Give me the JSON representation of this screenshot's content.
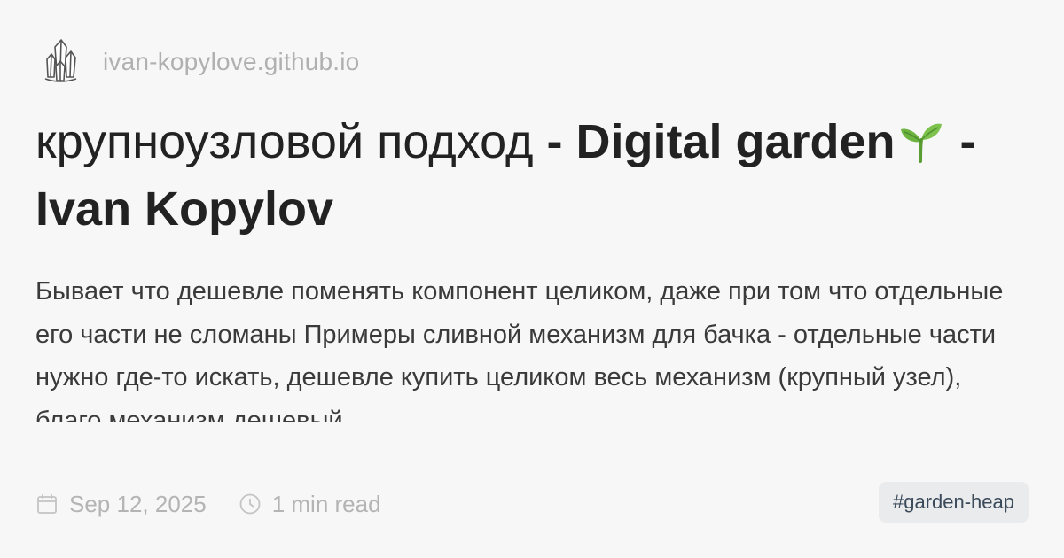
{
  "site": {
    "logo_icon": "crystal-icon",
    "url": "ivan-kopylove.github.io"
  },
  "title": {
    "part1": "крупноузловой подход",
    "part2": " - Digital garden",
    "sprout_icon": "seedling-icon",
    "part3": " - Ivan Kopylov"
  },
  "description": "Бывает что дешевле поменять компонент целиком, даже при том что отдельные его части не сломаны Примеры сливной механизм для бачка - отдельные части нужно где-то искать, дешевле купить целиком весь механизм (крупный узел), благо механизм дешевый",
  "meta": {
    "date_icon": "calendar-icon",
    "date": "Sep 12, 2025",
    "read_icon": "clock-icon",
    "read_time": "1 min read"
  },
  "tag": {
    "label": "#garden-heap"
  },
  "colors": {
    "background": "#f7f7f7",
    "title": "#222222",
    "muted": "#b0b0b0",
    "tag_bg": "#eaebec",
    "sprout_green": "#6cb33f"
  }
}
